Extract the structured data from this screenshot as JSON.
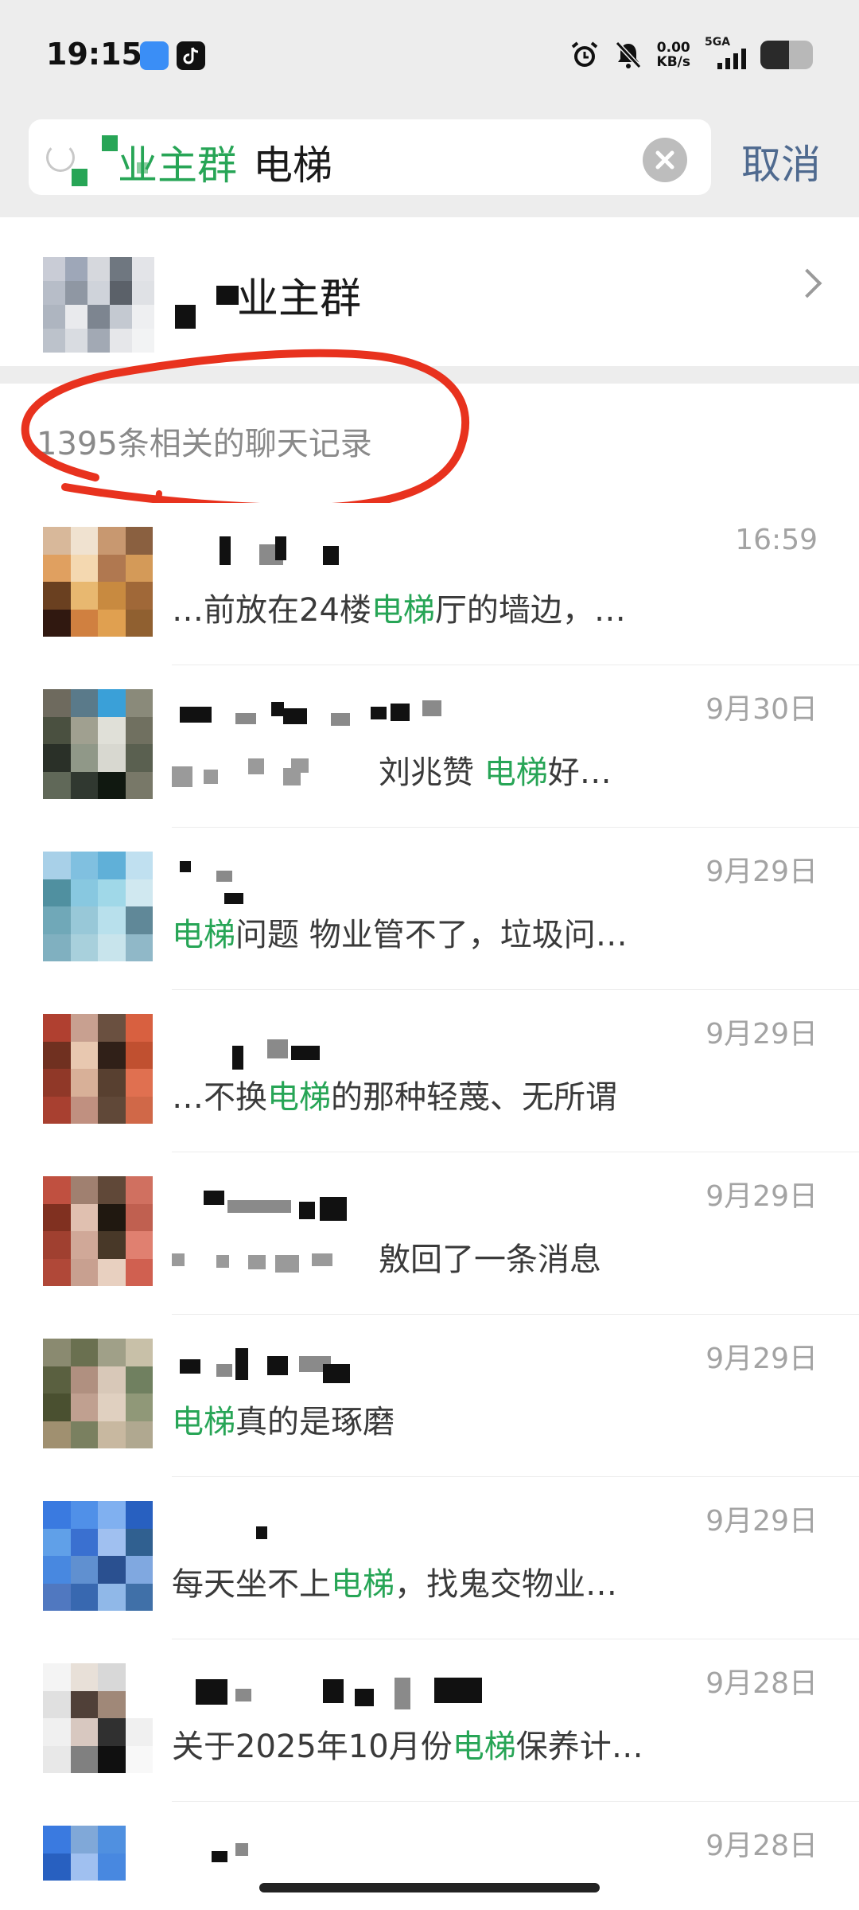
{
  "status_bar": {
    "time": "19:15",
    "net_speed_top": "0.00",
    "net_speed_bottom": "KB/s",
    "network": "5GA",
    "battery_level": 0.55,
    "icons": [
      "app-blue-icon",
      "tiktok-icon",
      "alarm-icon",
      "mute-bell-icon",
      "signal-icon",
      "battery-icon"
    ]
  },
  "search": {
    "query_highlight": "业主群",
    "query_keyword": "电梯",
    "cancel_label": "取消",
    "clear_icon": "clear-icon"
  },
  "group": {
    "name": "业主群",
    "chevron_icon": "chevron-right-icon"
  },
  "results": {
    "count_label": "1395条相关的聊天记录"
  },
  "messages": [
    {
      "time": "16:59",
      "pre": "…前放在24楼",
      "hl": "电梯",
      "post": "厅的墙边，…",
      "mask_before": false
    },
    {
      "time": "9月30日",
      "pre": "刘兆赞 ",
      "hl": "电梯",
      "post": "好…",
      "mask_before": true
    },
    {
      "time": "9月29日",
      "pre": "",
      "hl": "电梯",
      "post": "问题 物业管不了，垃圾问…",
      "mask_before": false
    },
    {
      "time": "9月29日",
      "pre": "…不换",
      "hl": "电梯",
      "post": "的那种轻蔑、无所谓",
      "mask_before": false
    },
    {
      "time": "9月29日",
      "pre": "敫回了一条消息",
      "hl": "",
      "post": "",
      "mask_before": true
    },
    {
      "time": "9月29日",
      "pre": "",
      "hl": "电梯",
      "post": "真的是琢磨",
      "mask_before": false
    },
    {
      "time": "9月29日",
      "pre": "每天坐不上",
      "hl": "电梯",
      "post": "，找鬼交物业…",
      "mask_before": false
    },
    {
      "time": "9月28日",
      "pre": "关于2025年10月份",
      "hl": "电梯",
      "post": "保养计…",
      "mask_before": false
    },
    {
      "time": "9月28日",
      "pre": "",
      "hl": "",
      "post": "",
      "mask_before": false
    }
  ],
  "colors": {
    "highlight": "#27a556",
    "cancel": "#4f6a8f",
    "annotation": "#e8321e",
    "header_bg": "#ededed"
  }
}
